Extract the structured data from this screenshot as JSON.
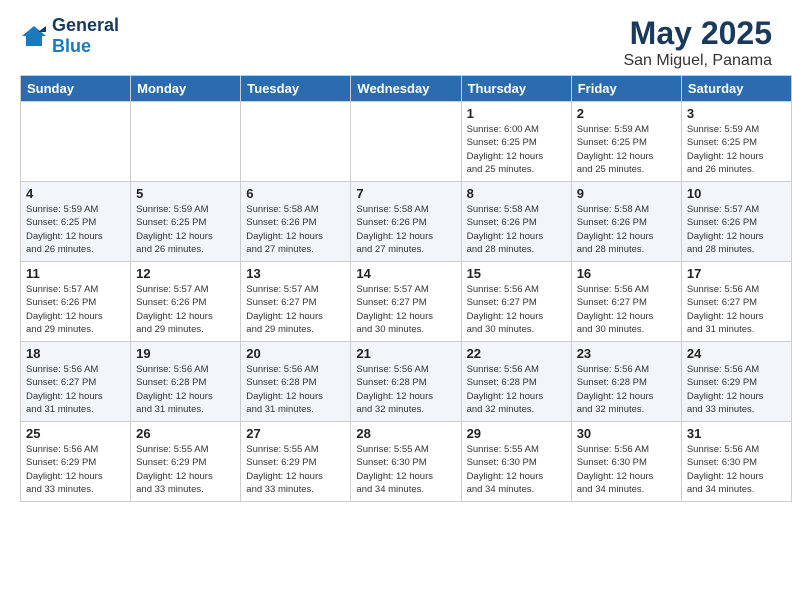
{
  "header": {
    "logo_general": "General",
    "logo_blue": "Blue",
    "month_title": "May 2025",
    "location": "San Miguel, Panama"
  },
  "calendar": {
    "headers": [
      "Sunday",
      "Monday",
      "Tuesday",
      "Wednesday",
      "Thursday",
      "Friday",
      "Saturday"
    ],
    "weeks": [
      [
        {
          "num": "",
          "info": ""
        },
        {
          "num": "",
          "info": ""
        },
        {
          "num": "",
          "info": ""
        },
        {
          "num": "",
          "info": ""
        },
        {
          "num": "1",
          "info": "Sunrise: 6:00 AM\nSunset: 6:25 PM\nDaylight: 12 hours\nand 25 minutes."
        },
        {
          "num": "2",
          "info": "Sunrise: 5:59 AM\nSunset: 6:25 PM\nDaylight: 12 hours\nand 25 minutes."
        },
        {
          "num": "3",
          "info": "Sunrise: 5:59 AM\nSunset: 6:25 PM\nDaylight: 12 hours\nand 26 minutes."
        }
      ],
      [
        {
          "num": "4",
          "info": "Sunrise: 5:59 AM\nSunset: 6:25 PM\nDaylight: 12 hours\nand 26 minutes."
        },
        {
          "num": "5",
          "info": "Sunrise: 5:59 AM\nSunset: 6:25 PM\nDaylight: 12 hours\nand 26 minutes."
        },
        {
          "num": "6",
          "info": "Sunrise: 5:58 AM\nSunset: 6:26 PM\nDaylight: 12 hours\nand 27 minutes."
        },
        {
          "num": "7",
          "info": "Sunrise: 5:58 AM\nSunset: 6:26 PM\nDaylight: 12 hours\nand 27 minutes."
        },
        {
          "num": "8",
          "info": "Sunrise: 5:58 AM\nSunset: 6:26 PM\nDaylight: 12 hours\nand 28 minutes."
        },
        {
          "num": "9",
          "info": "Sunrise: 5:58 AM\nSunset: 6:26 PM\nDaylight: 12 hours\nand 28 minutes."
        },
        {
          "num": "10",
          "info": "Sunrise: 5:57 AM\nSunset: 6:26 PM\nDaylight: 12 hours\nand 28 minutes."
        }
      ],
      [
        {
          "num": "11",
          "info": "Sunrise: 5:57 AM\nSunset: 6:26 PM\nDaylight: 12 hours\nand 29 minutes."
        },
        {
          "num": "12",
          "info": "Sunrise: 5:57 AM\nSunset: 6:26 PM\nDaylight: 12 hours\nand 29 minutes."
        },
        {
          "num": "13",
          "info": "Sunrise: 5:57 AM\nSunset: 6:27 PM\nDaylight: 12 hours\nand 29 minutes."
        },
        {
          "num": "14",
          "info": "Sunrise: 5:57 AM\nSunset: 6:27 PM\nDaylight: 12 hours\nand 30 minutes."
        },
        {
          "num": "15",
          "info": "Sunrise: 5:56 AM\nSunset: 6:27 PM\nDaylight: 12 hours\nand 30 minutes."
        },
        {
          "num": "16",
          "info": "Sunrise: 5:56 AM\nSunset: 6:27 PM\nDaylight: 12 hours\nand 30 minutes."
        },
        {
          "num": "17",
          "info": "Sunrise: 5:56 AM\nSunset: 6:27 PM\nDaylight: 12 hours\nand 31 minutes."
        }
      ],
      [
        {
          "num": "18",
          "info": "Sunrise: 5:56 AM\nSunset: 6:27 PM\nDaylight: 12 hours\nand 31 minutes."
        },
        {
          "num": "19",
          "info": "Sunrise: 5:56 AM\nSunset: 6:28 PM\nDaylight: 12 hours\nand 31 minutes."
        },
        {
          "num": "20",
          "info": "Sunrise: 5:56 AM\nSunset: 6:28 PM\nDaylight: 12 hours\nand 31 minutes."
        },
        {
          "num": "21",
          "info": "Sunrise: 5:56 AM\nSunset: 6:28 PM\nDaylight: 12 hours\nand 32 minutes."
        },
        {
          "num": "22",
          "info": "Sunrise: 5:56 AM\nSunset: 6:28 PM\nDaylight: 12 hours\nand 32 minutes."
        },
        {
          "num": "23",
          "info": "Sunrise: 5:56 AM\nSunset: 6:28 PM\nDaylight: 12 hours\nand 32 minutes."
        },
        {
          "num": "24",
          "info": "Sunrise: 5:56 AM\nSunset: 6:29 PM\nDaylight: 12 hours\nand 33 minutes."
        }
      ],
      [
        {
          "num": "25",
          "info": "Sunrise: 5:56 AM\nSunset: 6:29 PM\nDaylight: 12 hours\nand 33 minutes."
        },
        {
          "num": "26",
          "info": "Sunrise: 5:55 AM\nSunset: 6:29 PM\nDaylight: 12 hours\nand 33 minutes."
        },
        {
          "num": "27",
          "info": "Sunrise: 5:55 AM\nSunset: 6:29 PM\nDaylight: 12 hours\nand 33 minutes."
        },
        {
          "num": "28",
          "info": "Sunrise: 5:55 AM\nSunset: 6:30 PM\nDaylight: 12 hours\nand 34 minutes."
        },
        {
          "num": "29",
          "info": "Sunrise: 5:55 AM\nSunset: 6:30 PM\nDaylight: 12 hours\nand 34 minutes."
        },
        {
          "num": "30",
          "info": "Sunrise: 5:56 AM\nSunset: 6:30 PM\nDaylight: 12 hours\nand 34 minutes."
        },
        {
          "num": "31",
          "info": "Sunrise: 5:56 AM\nSunset: 6:30 PM\nDaylight: 12 hours\nand 34 minutes."
        }
      ]
    ]
  }
}
